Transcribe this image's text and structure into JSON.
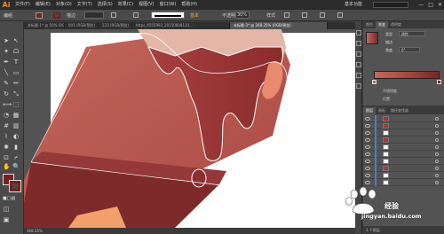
{
  "app": {
    "logo": "Ai"
  },
  "menubar": {
    "items": [
      "文件(F)",
      "编辑(E)",
      "对象(O)",
      "文字(T)",
      "选择(S)",
      "效果(C)",
      "视图(V)",
      "窗口(W)",
      "帮助(H)"
    ],
    "workspace": "基本功能",
    "window_controls": [
      "—",
      "□",
      "✕"
    ]
  },
  "controlbar": {
    "selection_label": "编组",
    "stroke_label": "描边",
    "style_label": "基本",
    "opacity_label": "不透明度",
    "opacity_value": "30%",
    "style_text": "样式"
  },
  "tabs": [
    {
      "label": "未标题-1* @ 50% (RGB/预览)",
      "active": false
    },
    {
      "label": "001 (RGB/预览)",
      "active": false
    },
    {
      "label": "123 (RGB/预览)",
      "active": false
    },
    {
      "label": "https_4555992_20150808110...",
      "active": false
    },
    {
      "label": "未标题-3* @ 368.35% (RGB/预览)",
      "active": true
    }
  ],
  "statusbar": {
    "text": "368.35%"
  },
  "gradient_panel": {
    "tabs": [
      "颜色",
      "渐变",
      "透明度"
    ],
    "active_tab": "渐变",
    "type_label": "类型",
    "type_value": "线性",
    "stroke_label": "描边",
    "angle_label": "角度",
    "angle_value": "0°",
    "opacity_label": "不透明度",
    "location_label": "位置",
    "colors": {
      "start": "#c46a5b",
      "mid": "#a2453d",
      "end": "#7a2525"
    }
  },
  "layers_panel": {
    "tabs": [
      "图层",
      "画板",
      "路径查找器"
    ],
    "active_tab": "图层",
    "rows": [
      {
        "thumb": "red"
      },
      {
        "thumb": "red"
      },
      {
        "thumb": "white"
      },
      {
        "thumb": "red"
      },
      {
        "thumb": "white"
      },
      {
        "thumb": "white"
      },
      {
        "thumb": "white"
      },
      {
        "thumb": "red"
      },
      {
        "thumb": "white"
      },
      {
        "thumb": "white"
      }
    ],
    "footer": "1 个图层"
  },
  "tools_panel": {
    "fill_color": "#7a1f1f",
    "stroke_color": "#7a1f1f"
  },
  "artwork": {
    "body_color": "#b35c52",
    "drip_color": "#8e2f2f",
    "band_color": "#7f2a2a",
    "highlight_color": "#f3a06a",
    "selection_color": "#ffffff"
  },
  "watermark": {
    "text": "经验",
    "url": "jingyan.baidu.com"
  }
}
